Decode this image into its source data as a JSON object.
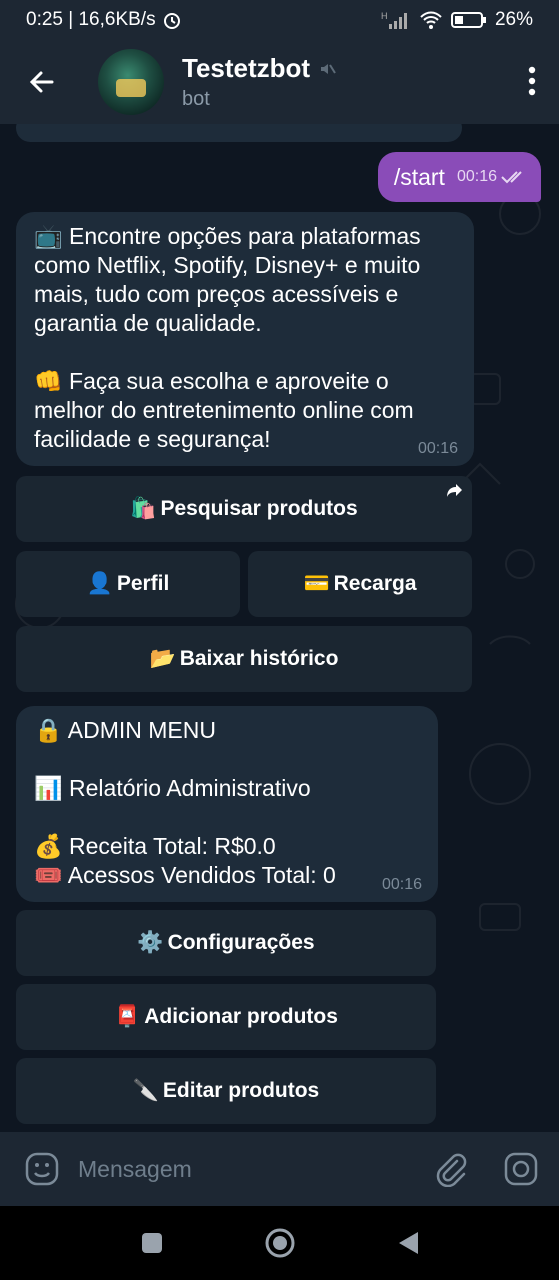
{
  "status": {
    "time_speed": "0:25 | 16,6KB/s",
    "battery": "26%"
  },
  "header": {
    "title": "Testetzbot",
    "subtitle": "bot"
  },
  "outgoing": {
    "text": "/start",
    "time": "00:16"
  },
  "welcome": {
    "line1": "📺 Encontre opções para plataformas como Netflix, Spotify, Disney+ e muito mais, tudo com preços acessíveis e garantia de qualidade.",
    "line2": "👊 Faça sua escolha e aproveite o melhor do entretenimento online com facilidade e segurança!",
    "time": "00:16"
  },
  "keyboard1": {
    "search": {
      "emoji": "🛍️",
      "label": "Pesquisar produtos"
    },
    "profile": {
      "emoji": "👤",
      "label": "Perfil"
    },
    "recharge": {
      "emoji": "💳",
      "label": "Recarga"
    },
    "history": {
      "emoji": "📂",
      "label": "Baixar histórico"
    }
  },
  "admin": {
    "title": "🔒 ADMIN MENU",
    "report": "📊 Relatório Administrativo",
    "revenue": "💰 Receita Total: R$0.0",
    "sold": "🎟️ Acessos Vendidos Total: 0",
    "time": "00:16"
  },
  "keyboard2": {
    "settings": {
      "emoji": "⚙️",
      "label": "Configurações"
    },
    "add": {
      "emoji": "📮",
      "label": "Adicionar produtos"
    },
    "edit": {
      "emoji": "🔪",
      "label": "Editar produtos"
    }
  },
  "composer": {
    "placeholder": "Mensagem"
  },
  "icons": {
    "back": "back-arrow-icon",
    "mute": "mute-icon",
    "more": "more-vert-icon",
    "emoji": "emoji-icon",
    "attach": "paperclip-icon",
    "camera": "camera-icon",
    "read": "double-check-icon",
    "share": "share-icon"
  },
  "colors": {
    "outgoing_bubble": "#8a4cb8",
    "incoming_bubble": "#1e2c3a",
    "header": "#1d2733",
    "background": "#0e1621"
  }
}
